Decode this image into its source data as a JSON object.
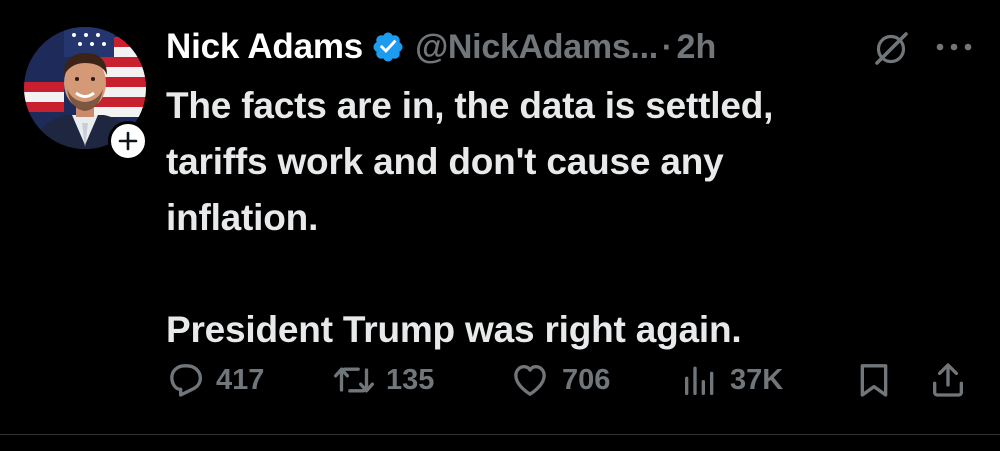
{
  "colors": {
    "background": "#000000",
    "text": "#e7e9ea",
    "muted": "#71767b",
    "verified": "#1d9bf0"
  },
  "author": {
    "display_name": "Nick Adams",
    "handle": "@NickAdams...",
    "separator": "·",
    "time": "2h",
    "verified": true
  },
  "tweet": {
    "lines": [
      "The facts are in, the data is settled,",
      "tariffs work and don't cause any",
      "inflation."
    ],
    "second_paragraph": "President Trump was right again."
  },
  "actions": {
    "replies": "417",
    "reposts": "135",
    "likes": "706",
    "views": "37K"
  },
  "icons": {
    "reply": "reply-icon",
    "repost": "repost-icon",
    "like": "heart-icon",
    "views": "views-icon",
    "bookmark": "bookmark-icon",
    "share": "share-icon",
    "grok": "grok-icon",
    "more": "more-icon",
    "follow": "plus-icon",
    "verified": "verified-badge-icon"
  }
}
